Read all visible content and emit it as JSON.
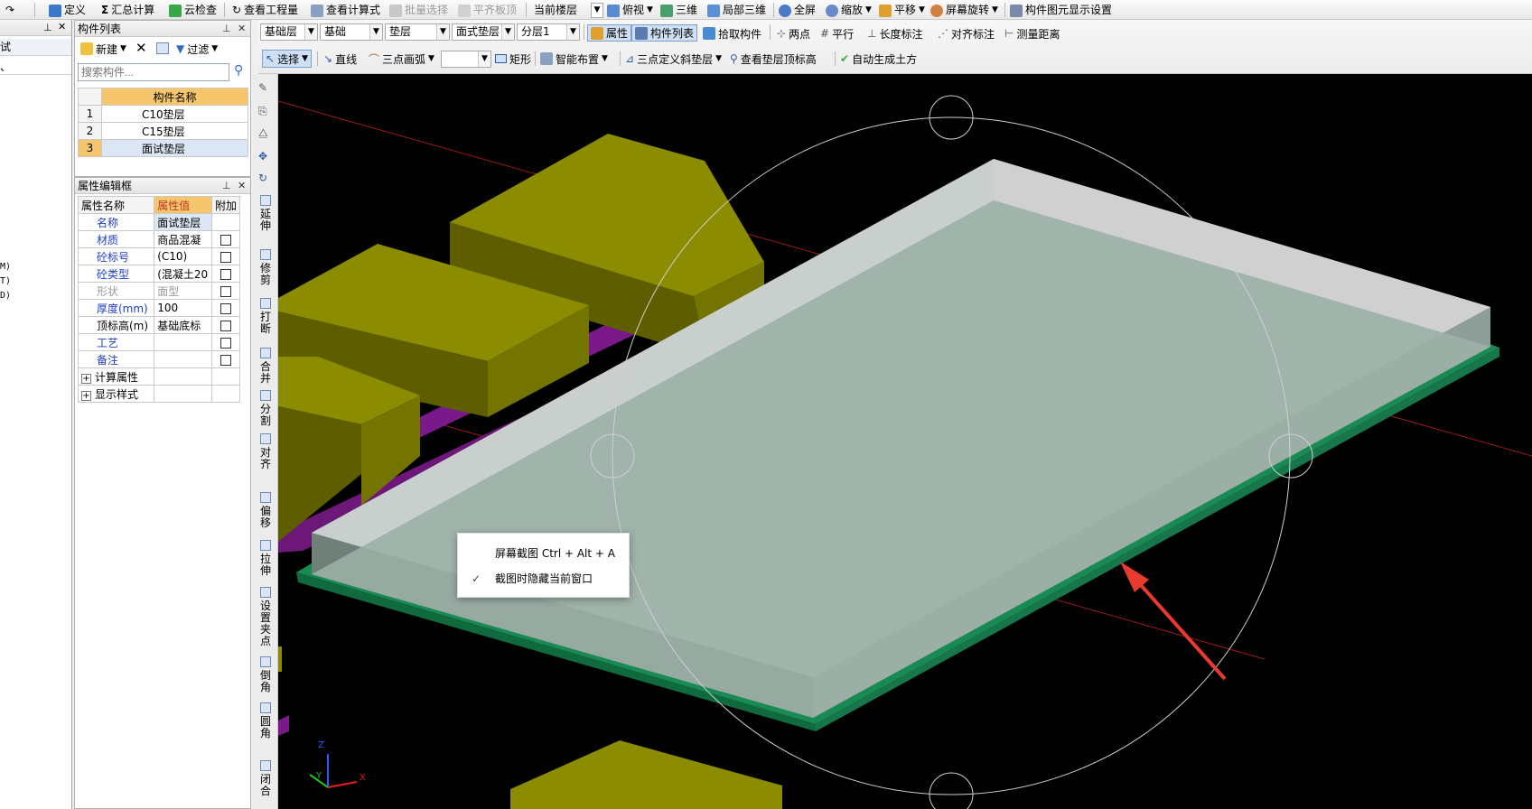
{
  "toolbar1": {
    "items": [
      "定义",
      "汇总计算",
      "云检查",
      "查看工程量",
      "查看计算式",
      "批量选择",
      "平齐板顶",
      "当前楼层",
      "俯视",
      "三维",
      "局部三维",
      "全屏",
      "缩放",
      "平移",
      "屏幕旋转",
      "构件图元显示设置"
    ]
  },
  "toolbar2": {
    "combos": [
      "基础层",
      "基础",
      "垫层",
      "面式垫层",
      "分层1"
    ],
    "buttons": [
      "属性",
      "构件列表",
      "拾取构件",
      "两点",
      "平行",
      "长度标注",
      "对齐标注",
      "测量距离"
    ]
  },
  "toolbar3": {
    "buttons": [
      "选择",
      "直线",
      "三点画弧",
      "矩形",
      "智能布置",
      "三点定义斜垫层",
      "查看垫层顶标高",
      "自动生成土方"
    ]
  },
  "left_strip": {
    "items": [
      "试",
      "、",
      "M)",
      "T)",
      "D)"
    ]
  },
  "component_list": {
    "title": "构件列表",
    "new_label": "新建",
    "filter_label": "过滤",
    "search_placeholder": "搜索构件...",
    "header": "构件名称",
    "rows": [
      {
        "num": "1",
        "name": "C10垫层"
      },
      {
        "num": "2",
        "name": "C15垫层"
      },
      {
        "num": "3",
        "name": "面试垫层"
      }
    ]
  },
  "property_editor": {
    "title": "属性编辑框",
    "headers": [
      "属性名称",
      "属性值",
      "附加"
    ],
    "rows": [
      {
        "name": "名称",
        "value": "面试垫层",
        "check": false
      },
      {
        "name": "材质",
        "value": "商品混凝",
        "check": true
      },
      {
        "name": "砼标号",
        "value": "(C10)",
        "check": true
      },
      {
        "name": "砼类型",
        "value": "(混凝土20",
        "check": true
      },
      {
        "name": "形状",
        "value": "面型",
        "check": true
      },
      {
        "name": "厚度(mm)",
        "value": "100",
        "check": true
      },
      {
        "name": "顶标高(m)",
        "value": "基础底标",
        "check": true
      },
      {
        "name": "工艺",
        "value": "",
        "check": true
      },
      {
        "name": "备注",
        "value": "",
        "check": true
      },
      {
        "name": "计算属性",
        "value": "",
        "check": false
      },
      {
        "name": "显示样式",
        "value": "",
        "check": false
      }
    ]
  },
  "vertical_toolbar": [
    "延伸",
    "修剪",
    "打断",
    "合并",
    "分割",
    "对齐",
    "偏移",
    "拉伸",
    "设置夹点",
    "倒角",
    "圆角",
    "闭合"
  ],
  "context_menu": {
    "items": [
      {
        "label": "屏幕截图 Ctrl + Alt + A",
        "checked": false
      },
      {
        "label": "截图时隐藏当前窗口",
        "checked": true
      }
    ]
  },
  "axes": {
    "x": "X",
    "y": "Y",
    "z": "Z"
  },
  "colors": {
    "viewport_bg": "#000000",
    "block_olive": "#8c8c00",
    "slab_top": "#a8b8b0",
    "slab_green": "#1a8a55",
    "beam_purple": "#7a1a8a",
    "header_orange": "#f5c66b",
    "selected_row": "#dbe7f5",
    "arrow_red": "#e83a2e"
  }
}
